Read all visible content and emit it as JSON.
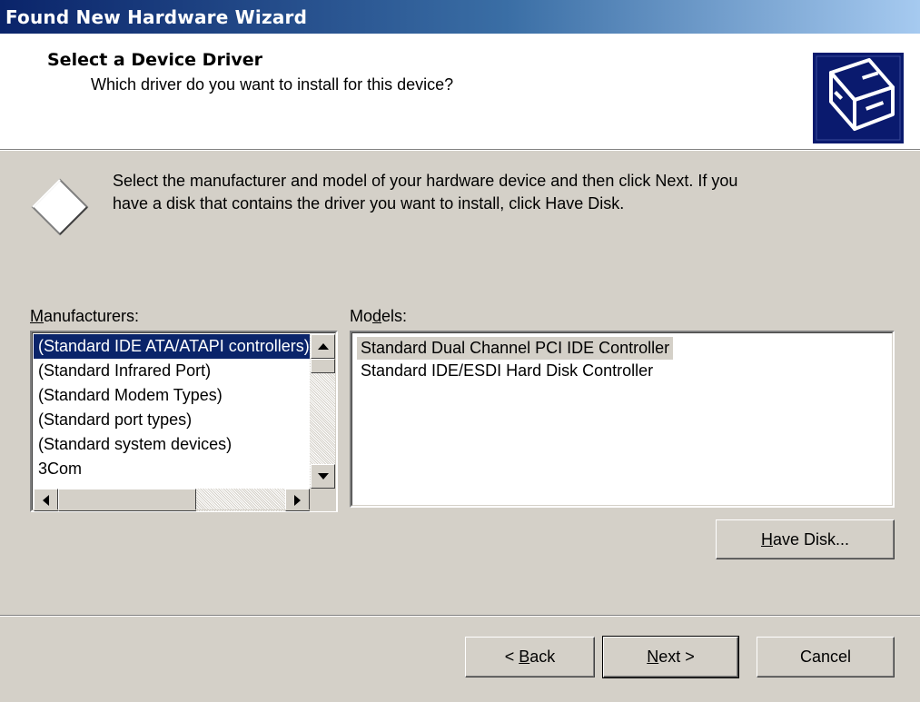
{
  "window": {
    "title": "Found New Hardware Wizard"
  },
  "header": {
    "title": "Select a Device Driver",
    "subtitle": "Which driver do you want to install for this device?",
    "icon": "hardware-card-icon"
  },
  "instructions": {
    "line1": "Select the manufacturer and model of your hardware device and then click Next. If you",
    "line2": "have a disk that contains the driver you want to install, click Have Disk.",
    "icon": "diamond-icon"
  },
  "manufacturers": {
    "label_accel": "M",
    "label_rest": "anufacturers:",
    "items": [
      "(Standard IDE ATA/ATAPI controllers)",
      "(Standard Infrared Port)",
      "(Standard Modem Types)",
      "(Standard port types)",
      "(Standard system devices)",
      "3Com"
    ],
    "selected_index": 0
  },
  "models": {
    "label_pre": "Mo",
    "label_accel": "d",
    "label_post": "els:",
    "items": [
      "Standard Dual Channel PCI IDE Controller",
      "Standard IDE/ESDI Hard Disk Controller"
    ],
    "selected_index": 0
  },
  "buttons": {
    "have_disk": {
      "accel": "H",
      "rest": "ave Disk..."
    },
    "back": {
      "pre": "< ",
      "accel": "B",
      "rest": "ack"
    },
    "next": {
      "accel": "N",
      "rest": "ext >"
    },
    "cancel": "Cancel"
  },
  "colors": {
    "face": "#d4d0c8",
    "selection": "#0a246a",
    "title_start": "#0a246a",
    "title_end": "#a6caf0"
  }
}
